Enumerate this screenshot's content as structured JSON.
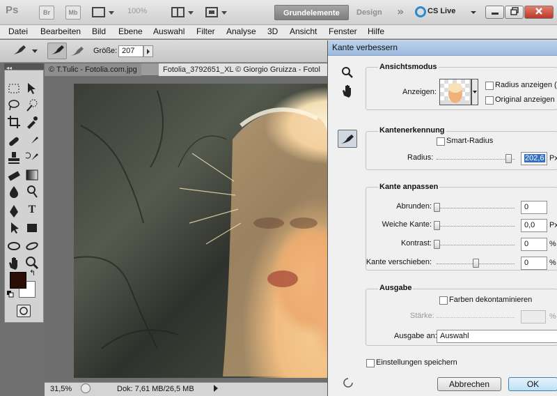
{
  "app": {
    "logo": "Ps",
    "bridge_icon": "Br",
    "minibridge_icon": "Mb",
    "zoom_level": "100%",
    "workspace_active": "Grundelemente",
    "workspace_inactive": "Design",
    "more": "»",
    "cs_live": "CS Live"
  },
  "menu": [
    "Datei",
    "Bearbeiten",
    "Bild",
    "Ebene",
    "Auswahl",
    "Filter",
    "Analyse",
    "3D",
    "Ansicht",
    "Fenster",
    "Hilfe"
  ],
  "options": {
    "size_label": "Größe:",
    "size_value": "207"
  },
  "tabs": [
    "© T.Tulic - Fotolia.com.jpg",
    "Fotolia_3792651_XL © Giorgio Gruizza - Fotol"
  ],
  "status": {
    "zoom": "31,5%",
    "doc": "Dok: 7,61 MB/26,5 MB"
  },
  "dialog": {
    "title": "Kante verbessern",
    "view": {
      "group": "Ansichtsmodus",
      "show_label": "Anzeigen:",
      "show_radius": "Radius anzeigen (J)",
      "show_original": "Original anzeigen (P)"
    },
    "edge_detection": {
      "group": "Kantenerkennung",
      "smart_radius": "Smart-Radius",
      "radius_label": "Radius:",
      "radius_value": "202,6",
      "radius_unit": "Px",
      "radius_level": 0.92
    },
    "adjust": {
      "group": "Kante anpassen",
      "rows": [
        {
          "label": "Abrunden:",
          "value": "0",
          "unit": "",
          "level": 0.0
        },
        {
          "label": "Weiche Kante:",
          "value": "0,0",
          "unit": "Px",
          "level": 0.0
        },
        {
          "label": "Kontrast:",
          "value": "0",
          "unit": "%",
          "level": 0.0
        },
        {
          "label": "Kante verschieben:",
          "value": "0",
          "unit": "%",
          "level": 0.5
        }
      ]
    },
    "output": {
      "group": "Ausgabe",
      "decontaminate": "Farben dekontaminieren",
      "strength_label": "Stärke:",
      "strength_unit": "%",
      "output_to_label": "Ausgabe an:",
      "output_to_value": "Auswahl"
    },
    "remember": "Einstellungen speichern",
    "cancel": "Abbrechen",
    "ok": "OK"
  }
}
